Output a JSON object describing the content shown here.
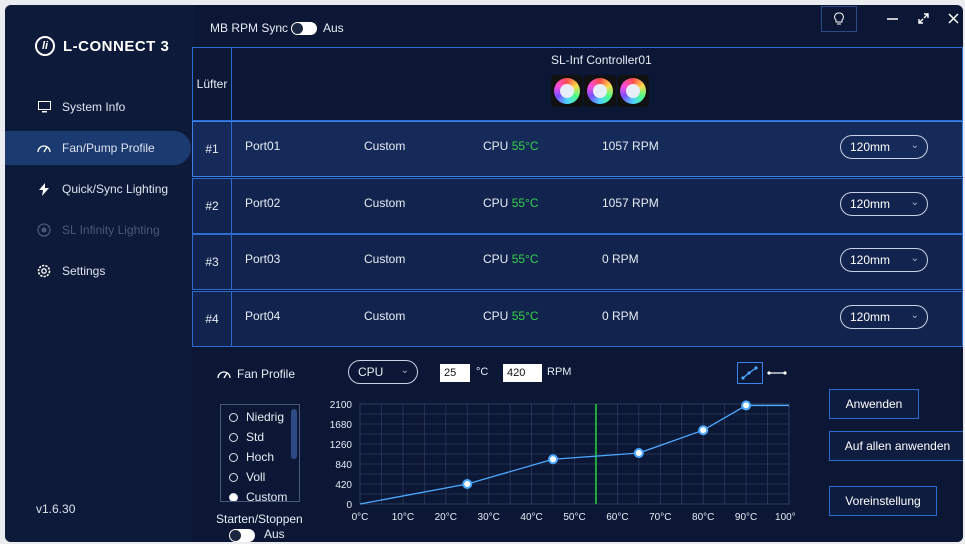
{
  "sidebar": {
    "app_title": "L-CONNECT 3",
    "items": [
      {
        "label": "System Info",
        "icon": "monitor-icon"
      },
      {
        "label": "Fan/Pump Profile",
        "icon": "gauge-icon"
      },
      {
        "label": "Quick/Sync Lighting",
        "icon": "bolt-icon"
      },
      {
        "label": "SL Infinity Lighting",
        "icon": "infinity-icon"
      },
      {
        "label": "Settings",
        "icon": "gear-icon"
      }
    ],
    "version": "v1.6.30"
  },
  "topbar": {
    "sync_label": "MB RPM Sync",
    "sync_state": "Aus",
    "buttons": [
      "bulb-icon",
      "minimize-icon",
      "maximize-icon",
      "close-icon"
    ]
  },
  "controller": {
    "column_label": "Lüfter",
    "name": "SL-Inf Controller01"
  },
  "ports": [
    {
      "num": "#1",
      "name": "Port01",
      "mode": "Custom",
      "sensor": "CPU",
      "temp": "55°C",
      "rpm": "1057 RPM",
      "size": "120mm"
    },
    {
      "num": "#2",
      "name": "Port02",
      "mode": "Custom",
      "sensor": "CPU",
      "temp": "55°C",
      "rpm": "1057 RPM",
      "size": "120mm"
    },
    {
      "num": "#3",
      "name": "Port03",
      "mode": "Custom",
      "sensor": "CPU",
      "temp": "55°C",
      "rpm": "0 RPM",
      "size": "120mm"
    },
    {
      "num": "#4",
      "name": "Port04",
      "mode": "Custom",
      "sensor": "CPU",
      "temp": "55°C",
      "rpm": "0 RPM",
      "size": "120mm"
    }
  ],
  "profile": {
    "label": "Fan Profile",
    "source": "CPU",
    "temp_value": "25",
    "temp_unit": "°C",
    "rpm_value": "420",
    "rpm_unit": "RPM",
    "presets": [
      "Niedrig",
      "Std",
      "Hoch",
      "Voll",
      "Custom"
    ],
    "selected_preset": "Custom",
    "start_stop_label": "Starten/Stoppen",
    "start_stop_state": "Aus",
    "apply": "Anwenden",
    "apply_all": "Auf allen anwenden",
    "default": "Voreinstellung"
  },
  "colors": {
    "accent": "#2c6bd0",
    "temp_green": "#35d04a",
    "curve": "#4da8ff",
    "current_line": "#1faa3a"
  },
  "chart_data": {
    "type": "line",
    "x": [
      0,
      25,
      45,
      65,
      80,
      90,
      100
    ],
    "y": [
      0,
      420,
      940,
      1070,
      1550,
      2070,
      2070
    ],
    "current_temp": 55,
    "xlim": [
      0,
      100
    ],
    "ylim": [
      0,
      2100
    ],
    "x_ticks": [
      "0°C",
      "10°C",
      "20°C",
      "30°C",
      "40°C",
      "50°C",
      "60°C",
      "70°C",
      "80°C",
      "90°C",
      "100°C"
    ],
    "y_ticks": [
      "0",
      "420",
      "840",
      "1260",
      "1680",
      "2100"
    ],
    "grid": true
  }
}
